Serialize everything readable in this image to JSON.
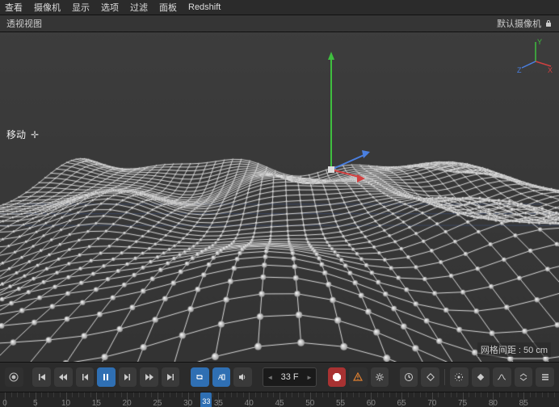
{
  "menubar": {
    "items": [
      "查看",
      "摄像机",
      "显示",
      "选项",
      "过滤",
      "面板",
      "Redshift"
    ]
  },
  "viewport": {
    "title": "透视视图",
    "camera_label": "默认摄像机",
    "tool_label": "移动",
    "grid_info": "网格间距 : 50 cm",
    "axes": {
      "x": "X",
      "y": "Y",
      "z": "Z"
    }
  },
  "timeline": {
    "frame_value": "33 F",
    "ruler": {
      "start": 0,
      "end": 90,
      "major": [
        0,
        5,
        10,
        15,
        20,
        25,
        30,
        35,
        40,
        45,
        50,
        55,
        60,
        65,
        70,
        75,
        80,
        85
      ],
      "playhead": 33
    }
  },
  "icons": {
    "rec": "rec",
    "goto_start": "goto-start",
    "prev_key": "prev-key",
    "prev_frame": "prev-frame",
    "play": "play",
    "next_frame": "next-frame",
    "next_key": "next-key",
    "goto_end": "goto-end",
    "loop": "loop",
    "autokey": "autokey",
    "sound": "sound",
    "stop": "stop",
    "warn": "warn",
    "gear": "gear",
    "clock": "clock",
    "key": "key",
    "dope": "dope",
    "marker": "marker",
    "fcurve": "fcurve",
    "expand": "expand",
    "menu": "menu"
  }
}
